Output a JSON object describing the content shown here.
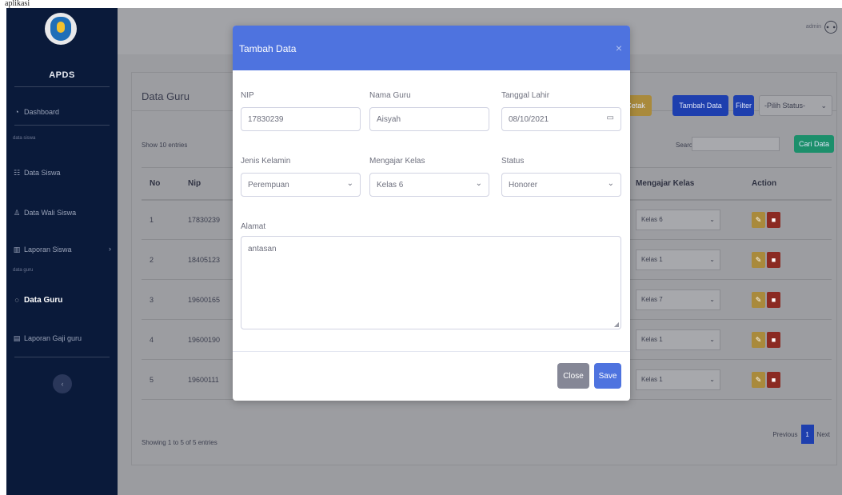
{
  "caption": "aplikasi",
  "sidebar": {
    "brand": "APDS",
    "items": [
      {
        "label": "Dashboard",
        "icon": "gauge-icon"
      },
      {
        "label": "Data Siswa",
        "icon": "users-icon"
      },
      {
        "label": "Data Wali Siswa",
        "icon": "user-icon"
      },
      {
        "label": "Laporan Siswa",
        "icon": "chart-icon"
      },
      {
        "label": "Data Guru",
        "icon": "chat-icon"
      },
      {
        "label": "Laporan Gaji guru",
        "icon": "file-icon"
      }
    ],
    "sections": [
      "data siswa",
      "data guru"
    ]
  },
  "topbar": {
    "user": "admin"
  },
  "page": {
    "title": "Data Guru",
    "buttons": {
      "print": "Cetak",
      "add": "Tambah Data",
      "filter": "Filter",
      "status_select": "-Pilih Status-",
      "search_btn": "Cari Data"
    },
    "show_entries": "Show 10 entries",
    "search_label": "Search:",
    "columns": [
      "No",
      "Nip",
      "Mengajar Kelas",
      "Action"
    ],
    "rows": [
      {
        "no": "1",
        "nip": "17830239",
        "kelas": "Kelas 6"
      },
      {
        "no": "2",
        "nip": "18405123",
        "kelas": "Kelas 1"
      },
      {
        "no": "3",
        "nip": "19600165",
        "kelas": "Kelas 7"
      },
      {
        "no": "4",
        "nip": "19600190",
        "kelas": "Kelas 1"
      },
      {
        "no": "5",
        "nip": "19600111",
        "kelas": "Kelas 1"
      }
    ],
    "footer": "Showing 1 to 5 of 5 entries",
    "pager": {
      "prev": "Previous",
      "current": "1",
      "next": "Next"
    }
  },
  "modal": {
    "title": "Tambah Data",
    "close": "×",
    "fields": {
      "nip": {
        "label": "NIP",
        "value": "17830239"
      },
      "nama": {
        "label": "Nama Guru",
        "value": "Aisyah"
      },
      "tgl": {
        "label": "Tanggal Lahir",
        "value": "08/10/2021"
      },
      "jk": {
        "label": "Jenis Kelamin",
        "value": "Perempuan"
      },
      "kelas": {
        "label": "Mengajar Kelas",
        "value": "Kelas 6"
      },
      "status": {
        "label": "Status",
        "value": "Honorer"
      },
      "alamat": {
        "label": "Alamat",
        "value": "antasan"
      }
    },
    "close_btn": "Close",
    "save_btn": "Save"
  },
  "colors": {
    "primary": "#4e73df",
    "sidebar": "#0a1a3a",
    "warning": "#f6c23e",
    "danger": "#e74a3b",
    "secondary": "#858796"
  }
}
